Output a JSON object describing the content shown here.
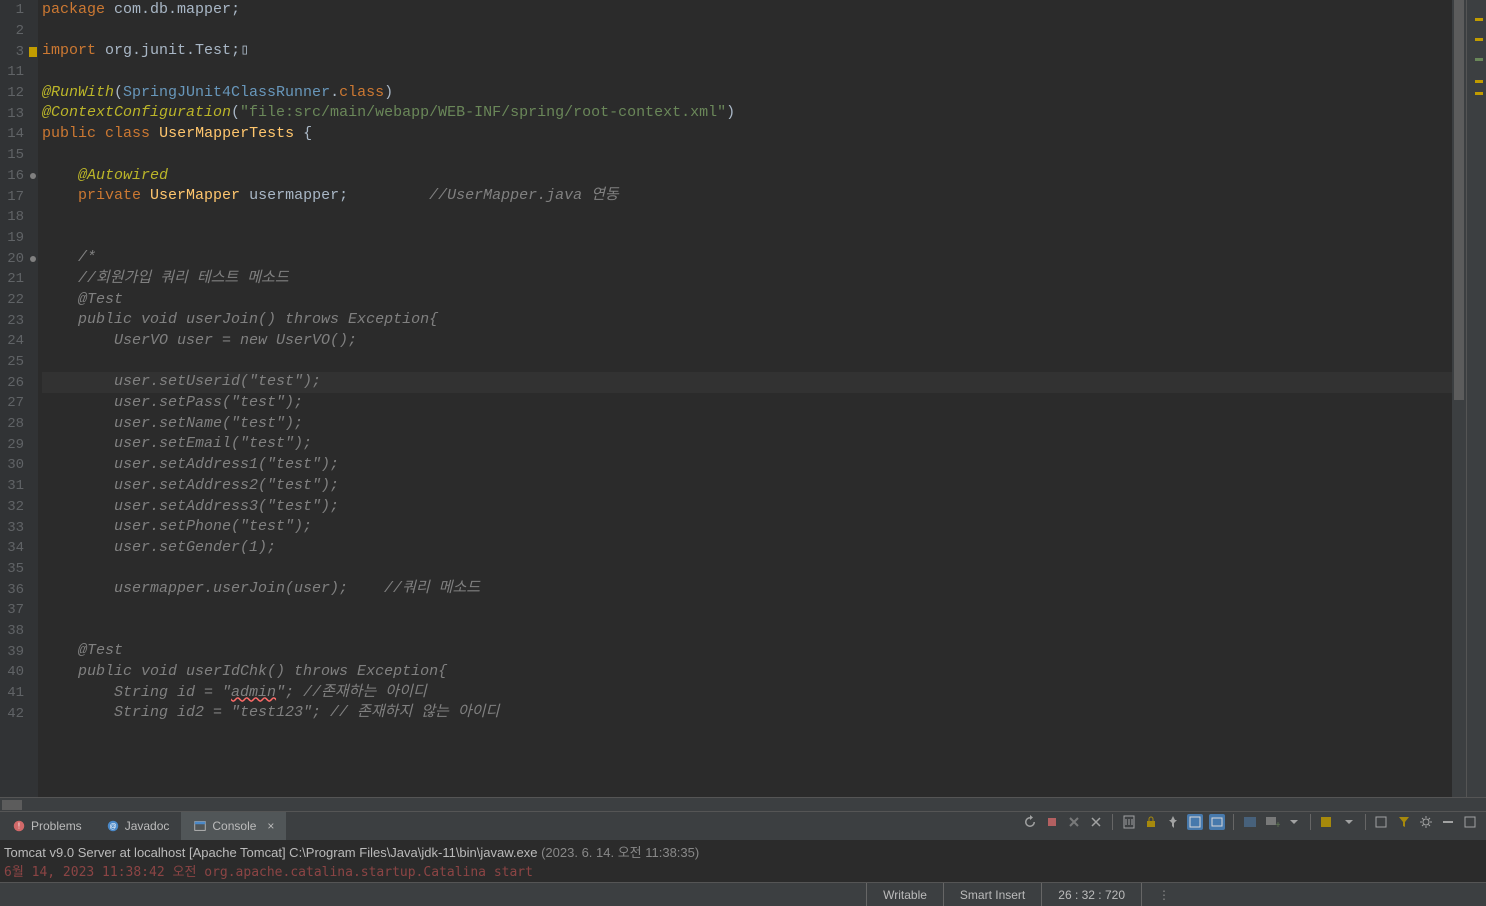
{
  "code": {
    "lines": [
      {
        "num": "1",
        "segments": [
          {
            "cls": "kw",
            "t": "package"
          },
          {
            "cls": "",
            "t": " "
          },
          {
            "cls": "pkg",
            "t": "com.db.mapper"
          },
          {
            "cls": "",
            "t": ";"
          }
        ]
      },
      {
        "num": "2",
        "segments": []
      },
      {
        "num": "3",
        "marker": "warn",
        "fold": true,
        "segments": [
          {
            "cls": "kw",
            "t": "import"
          },
          {
            "cls": "",
            "t": " "
          },
          {
            "cls": "pkg",
            "t": "org.junit.Test"
          },
          {
            "cls": "",
            "t": ";"
          },
          {
            "cls": "",
            "t": "▯"
          }
        ]
      },
      {
        "num": "11",
        "segments": []
      },
      {
        "num": "12",
        "segments": [
          {
            "cls": "annotation",
            "t": "@RunWith"
          },
          {
            "cls": "",
            "t": "("
          },
          {
            "cls": "class-ref",
            "t": "SpringJUnit4ClassRunner"
          },
          {
            "cls": "",
            "t": "."
          },
          {
            "cls": "kw",
            "t": "class"
          },
          {
            "cls": "",
            "t": ")"
          }
        ]
      },
      {
        "num": "13",
        "segments": [
          {
            "cls": "annotation",
            "t": "@ContextConfiguration"
          },
          {
            "cls": "",
            "t": "("
          },
          {
            "cls": "str",
            "t": "\"file:src/main/webapp/WEB-INF/spring/root-context.xml\""
          },
          {
            "cls": "",
            "t": ")"
          }
        ]
      },
      {
        "num": "14",
        "segments": [
          {
            "cls": "kw",
            "t": "public"
          },
          {
            "cls": "",
            "t": " "
          },
          {
            "cls": "kw",
            "t": "class"
          },
          {
            "cls": "",
            "t": " "
          },
          {
            "cls": "classname",
            "t": "UserMapperTests"
          },
          {
            "cls": "",
            "t": " {"
          }
        ]
      },
      {
        "num": "15",
        "segments": []
      },
      {
        "num": "16",
        "marker": "dot",
        "segments": [
          {
            "cls": "",
            "t": "    "
          },
          {
            "cls": "annotation",
            "t": "@Autowired"
          }
        ]
      },
      {
        "num": "17",
        "segments": [
          {
            "cls": "",
            "t": "    "
          },
          {
            "cls": "kw",
            "t": "private"
          },
          {
            "cls": "",
            "t": " "
          },
          {
            "cls": "classname",
            "t": "UserMapper"
          },
          {
            "cls": "",
            "t": " "
          },
          {
            "cls": "",
            "t": "usermapper"
          },
          {
            "cls": "",
            "t": ";         "
          },
          {
            "cls": "comment",
            "t": "//UserMapper.java 연동"
          }
        ]
      },
      {
        "num": "18",
        "segments": []
      },
      {
        "num": "19",
        "segments": []
      },
      {
        "num": "20",
        "marker": "dot",
        "segments": [
          {
            "cls": "",
            "t": "    "
          },
          {
            "cls": "comment",
            "t": "/*"
          }
        ]
      },
      {
        "num": "21",
        "segments": [
          {
            "cls": "",
            "t": "    "
          },
          {
            "cls": "comment",
            "t": "//회원가입 쿼리 테스트 메소드"
          }
        ]
      },
      {
        "num": "22",
        "segments": [
          {
            "cls": "",
            "t": "    "
          },
          {
            "cls": "comment",
            "t": "@Test"
          }
        ]
      },
      {
        "num": "23",
        "segments": [
          {
            "cls": "",
            "t": "    "
          },
          {
            "cls": "comment",
            "t": "public void userJoin() throws Exception{"
          }
        ]
      },
      {
        "num": "24",
        "segments": [
          {
            "cls": "",
            "t": "        "
          },
          {
            "cls": "comment",
            "t": "UserVO user = new UserVO();"
          }
        ]
      },
      {
        "num": "25",
        "segments": []
      },
      {
        "num": "26",
        "highlighted": true,
        "segments": [
          {
            "cls": "",
            "t": "        "
          },
          {
            "cls": "comment",
            "t": "user.setUserid(\"test\");"
          }
        ]
      },
      {
        "num": "27",
        "segments": [
          {
            "cls": "",
            "t": "        "
          },
          {
            "cls": "comment",
            "t": "user.setPass(\"test\");"
          }
        ]
      },
      {
        "num": "28",
        "segments": [
          {
            "cls": "",
            "t": "        "
          },
          {
            "cls": "comment",
            "t": "user.setName(\"test\");"
          }
        ]
      },
      {
        "num": "29",
        "segments": [
          {
            "cls": "",
            "t": "        "
          },
          {
            "cls": "comment",
            "t": "user.setEmail(\"test\");"
          }
        ]
      },
      {
        "num": "30",
        "segments": [
          {
            "cls": "",
            "t": "        "
          },
          {
            "cls": "comment",
            "t": "user.setAddress1(\"test\");"
          }
        ]
      },
      {
        "num": "31",
        "segments": [
          {
            "cls": "",
            "t": "        "
          },
          {
            "cls": "comment",
            "t": "user.setAddress2(\"test\");"
          }
        ]
      },
      {
        "num": "32",
        "segments": [
          {
            "cls": "",
            "t": "        "
          },
          {
            "cls": "comment",
            "t": "user.setAddress3(\"test\");"
          }
        ]
      },
      {
        "num": "33",
        "segments": [
          {
            "cls": "",
            "t": "        "
          },
          {
            "cls": "comment",
            "t": "user.setPhone(\"test\");"
          }
        ]
      },
      {
        "num": "34",
        "segments": [
          {
            "cls": "",
            "t": "        "
          },
          {
            "cls": "comment",
            "t": "user.setGender(1);"
          }
        ]
      },
      {
        "num": "35",
        "segments": []
      },
      {
        "num": "36",
        "segments": [
          {
            "cls": "",
            "t": "        "
          },
          {
            "cls": "comment",
            "t": "usermapper.userJoin(user);    //쿼리 메소드"
          }
        ]
      },
      {
        "num": "37",
        "segments": []
      },
      {
        "num": "38",
        "segments": []
      },
      {
        "num": "39",
        "segments": [
          {
            "cls": "",
            "t": "    "
          },
          {
            "cls": "comment",
            "t": "@Test"
          }
        ]
      },
      {
        "num": "40",
        "segments": [
          {
            "cls": "",
            "t": "    "
          },
          {
            "cls": "comment",
            "t": "public void userIdChk() throws Exception{"
          }
        ]
      },
      {
        "num": "41",
        "segments": [
          {
            "cls": "",
            "t": "        "
          },
          {
            "cls": "comment",
            "t": "String id = \""
          },
          {
            "cls": "comment underline-err",
            "t": "admin"
          },
          {
            "cls": "comment",
            "t": "\"; //존재하는 아이디"
          }
        ]
      },
      {
        "num": "42",
        "segments": [
          {
            "cls": "",
            "t": "        "
          },
          {
            "cls": "comment",
            "t": "String id2 = \"test123\"; // 존재하지 않는 아이디"
          }
        ]
      }
    ]
  },
  "tabs": {
    "problems": "Problems",
    "javadoc": "Javadoc",
    "console": "Console"
  },
  "console": {
    "title_prefix": "Tomcat v9.0 Server at localhost [Apache Tomcat] C:\\Program Files\\Java\\jdk-11\\bin\\javaw.exe",
    "title_date": "  (2023. 6. 14. 오전 11:38:35)",
    "log_line": "6월 14, 2023 11:38:42 오전 org.apache.catalina.startup.Catalina start"
  },
  "status": {
    "writable": "Writable",
    "insert": "Smart Insert",
    "cursor": "26 : 32 : 720"
  }
}
